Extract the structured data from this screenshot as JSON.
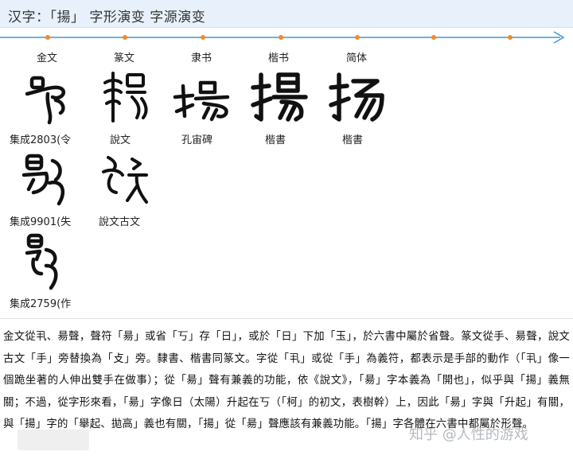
{
  "header": {
    "title": "汉字：「揚」 字形演变 字源演变"
  },
  "timeline": {
    "line_color": "#3d9ad1",
    "dot_color": "#f08a2c",
    "stages": [
      "金文",
      "篆文",
      "隶书",
      "楷书",
      "简体"
    ]
  },
  "glyph_captions": {
    "row1": [
      "集成2803(令",
      "說文",
      "孔宙碑",
      "楷書",
      "楷書"
    ],
    "row2": [
      "集成9901(失",
      "說文古文"
    ],
    "row3": [
      "集成2759(作"
    ]
  },
  "description": "金文從丮、昜聲，聲符「昜」或省「丂」存「日」，或於「日」下加「玉」，於六書中屬於省聲。篆文從手、昜聲，說文古文「手」旁替換為「攴」旁。隸書、楷書同篆文。字從「丮」或從「手」為義符，都表示是手部的動作（「丮」像一個跪坐著的人伸出雙手在做事）；從「昜」聲有兼義的功能，依《說文》，「昜」字本義為「開也」，似乎與「揚」義無關；不過，從字形來看，「昜」字像日（太陽）升起在丂（「柯」的初文，表樹幹）上，因此「昜」字與「升起」有關，與「揚」字的「舉起、拋高」義也有關，「揚」從「昜」聲應該有兼義功能。「揚」字各體在六書中都屬於形聲。",
  "watermark": "知乎 @人性的游戏"
}
